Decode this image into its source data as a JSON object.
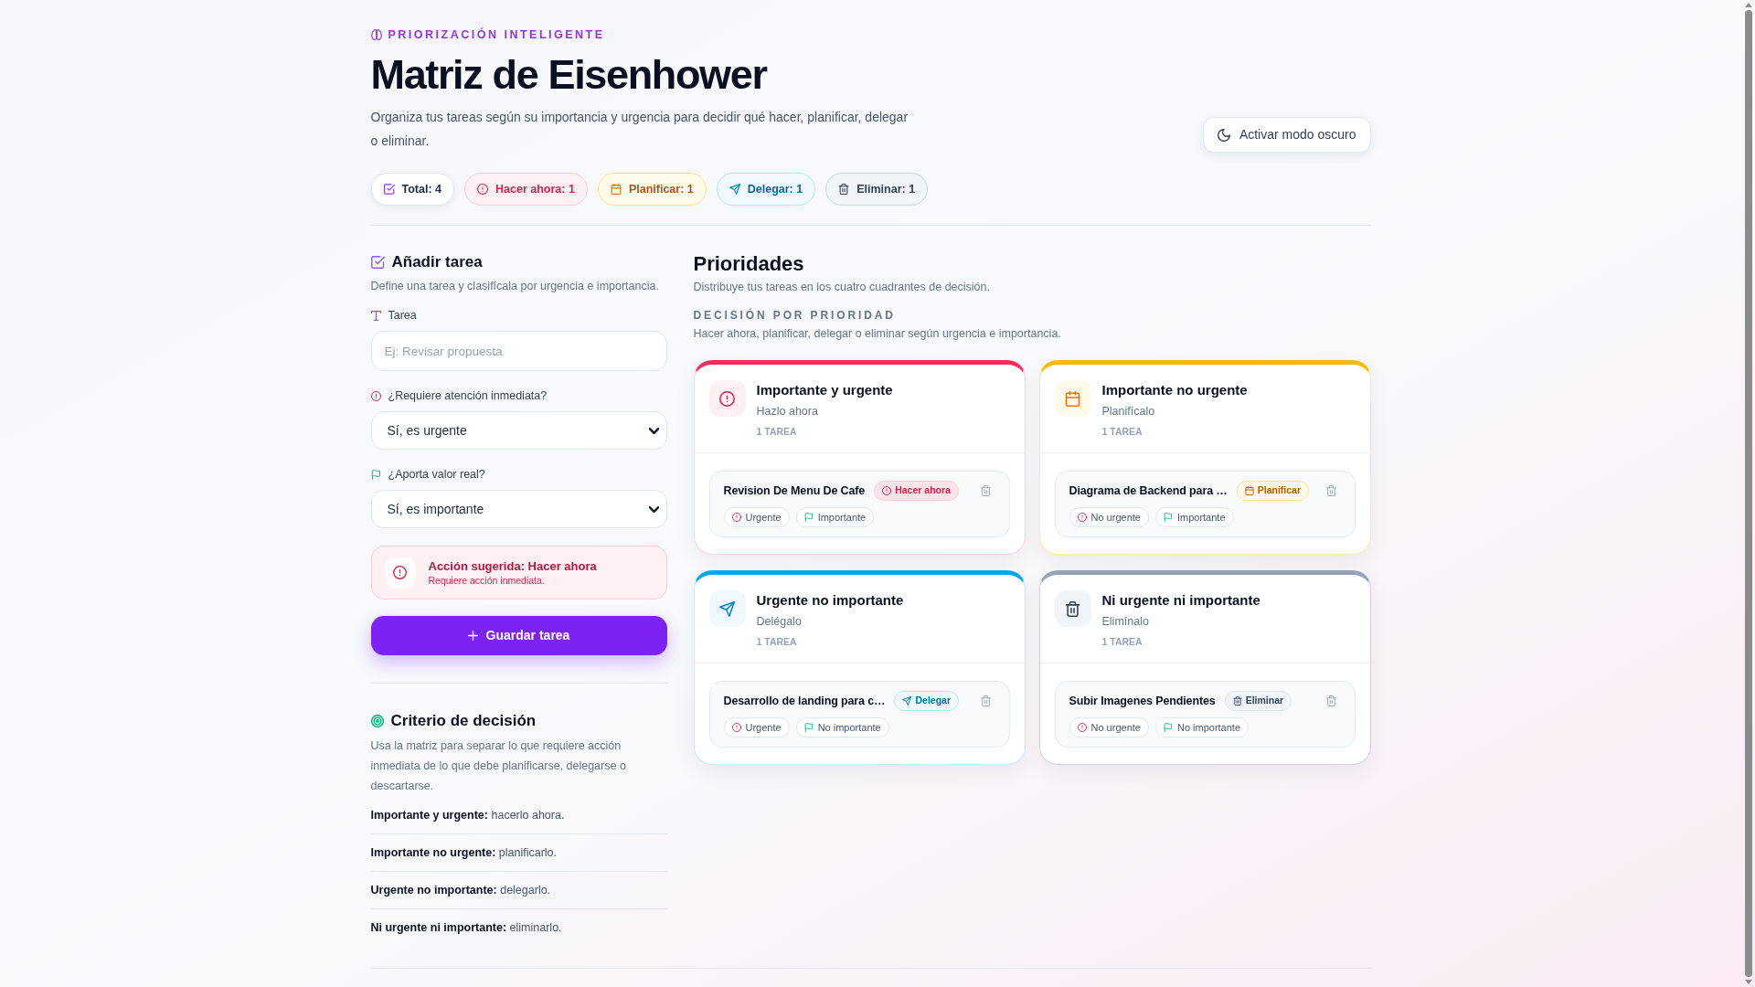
{
  "header": {
    "eyebrow": "PRIORIZACIÓN INTELIGENTE",
    "title": "Matriz de Eisenhower",
    "description": "Organiza tus tareas según su importancia y urgencia para decidir qué hacer, planificar, delegar o eliminar.",
    "theme_button": "Activar modo oscuro"
  },
  "stats": [
    {
      "kind": "total",
      "label": "Total: 4"
    },
    {
      "kind": "do",
      "label": "Hacer ahora: 1"
    },
    {
      "kind": "plan",
      "label": "Planificar: 1"
    },
    {
      "kind": "delegate",
      "label": "Delegar: 1"
    },
    {
      "kind": "delete",
      "label": "Eliminar: 1"
    }
  ],
  "add_task": {
    "title": "Añadir tarea",
    "description": "Define una tarea y clasifícala por urgencia e importancia.",
    "fields": [
      {
        "kind": "text",
        "label": "Tarea",
        "placeholder": "Ej: Revisar propuesta"
      },
      {
        "kind": "urgency",
        "label": "¿Requiere atención inmediata?",
        "value": "Sí, es urgente"
      },
      {
        "kind": "importance",
        "label": "¿Aporta valor real?",
        "value": "Sí, es importante"
      }
    ],
    "suggestion": {
      "kind": "do",
      "title": "Acción sugerida: Hacer ahora",
      "text": "Requiere acción inmediata."
    },
    "submit": "Guardar tarea"
  },
  "criteria": {
    "title": "Criterio de decisión",
    "description": "Usa la matriz para separar lo que requiere acción inmediata de lo que debe planificarse, delegarse o descartarse.",
    "items": [
      "**Importante y urgente:** hacerlo ahora.",
      "**Importante no urgente:** planificarlo.",
      "**Urgente no importante:** delegarlo.",
      "**Ni urgente ni importante:** eliminarlo."
    ]
  },
  "priorities": {
    "title": "Prioridades",
    "description": "Distribuye tus tareas en los cuatro cuadrantes de decisión.",
    "section_label": "DECISIÓN POR PRIORIDAD",
    "section_description": "Hacer ahora, planificar, delegar o eliminar según urgencia e importancia.",
    "quadrants": [
      {
        "kind": "do",
        "title": "Importante y urgente",
        "subtitle": "Hazlo ahora",
        "count": "1 TAREA",
        "tasks": [
          {
            "title": "Revision De Menu De Cafe",
            "badge": "Hacer ahora",
            "tags": [
              {
                "kind": "urgency",
                "label": "Urgente"
              },
              {
                "kind": "importance",
                "label": "Importante"
              }
            ]
          }
        ]
      },
      {
        "kind": "plan",
        "title": "Importante no urgente",
        "subtitle": "Planifícalo",
        "count": "1 TAREA",
        "tasks": [
          {
            "title": "Diagrama de Backend para …",
            "badge": "Planificar",
            "tags": [
              {
                "kind": "urgency",
                "label": "No urgente"
              },
              {
                "kind": "importance",
                "label": "Importante"
              }
            ]
          }
        ]
      },
      {
        "kind": "delegate",
        "title": "Urgente no importante",
        "subtitle": "Delégalo",
        "count": "1 TAREA",
        "tasks": [
          {
            "title": "Desarrollo de landing para c…",
            "badge": "Delegar",
            "tags": [
              {
                "kind": "urgency",
                "label": "Urgente"
              },
              {
                "kind": "importance",
                "label": "No importante"
              }
            ]
          }
        ]
      },
      {
        "kind": "delete",
        "title": "Ni urgente ni importante",
        "subtitle": "Elimínalo",
        "count": "1 TAREA",
        "tasks": [
          {
            "title": "Subir Imagenes Pendientes",
            "badge": "Eliminar",
            "tags": [
              {
                "kind": "urgency",
                "label": "No urgente"
              },
              {
                "kind": "importance",
                "label": "No importante"
              }
            ]
          }
        ]
      }
    ]
  }
}
